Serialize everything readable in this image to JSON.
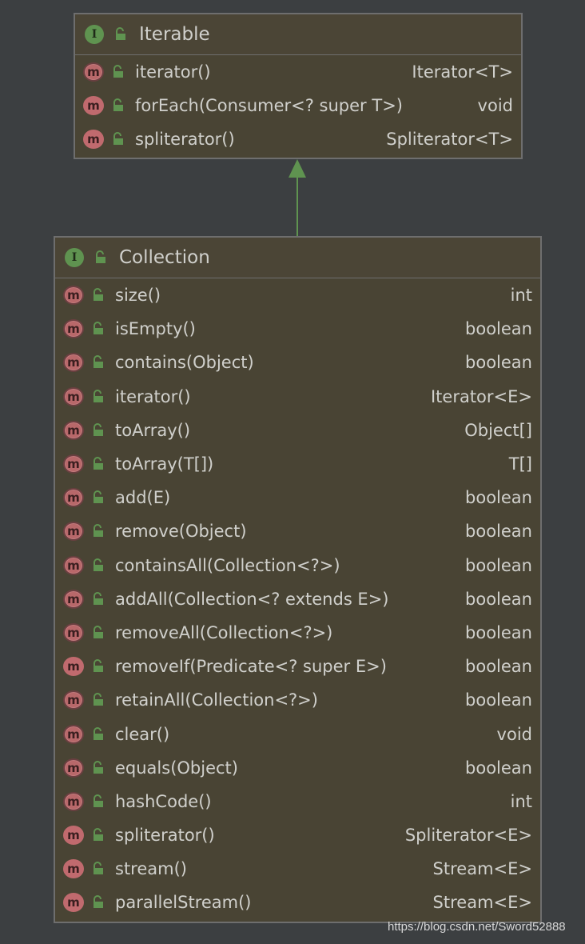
{
  "colors": {
    "background": "#3c3f41",
    "box_fill": "#494434",
    "box_border": "#6e6e6e",
    "interface_badge": "#5f9350",
    "method_badge": "#c06a6e",
    "access_lock": "#5f9350",
    "arrow": "#5f9350",
    "text": "#d0d0cc"
  },
  "iterable": {
    "badge": "I",
    "title": "Iterable",
    "methods": [
      {
        "badge": "m",
        "abstract": true,
        "icon": "public-lock-icon",
        "signature": "iterator()",
        "returns": "Iterator<T>"
      },
      {
        "badge": "m",
        "abstract": false,
        "icon": "public-lock-icon",
        "signature": "forEach(Consumer<? super T>)",
        "returns": "void"
      },
      {
        "badge": "m",
        "abstract": false,
        "icon": "public-lock-icon",
        "signature": "spliterator()",
        "returns": "Spliterator<T>"
      }
    ]
  },
  "collection": {
    "badge": "I",
    "title": "Collection",
    "methods": [
      {
        "badge": "m",
        "abstract": true,
        "icon": "public-lock-icon",
        "signature": "size()",
        "returns": "int"
      },
      {
        "badge": "m",
        "abstract": true,
        "icon": "public-lock-icon",
        "signature": "isEmpty()",
        "returns": "boolean"
      },
      {
        "badge": "m",
        "abstract": true,
        "icon": "public-lock-icon",
        "signature": "contains(Object)",
        "returns": "boolean"
      },
      {
        "badge": "m",
        "abstract": true,
        "icon": "public-lock-icon",
        "signature": "iterator()",
        "returns": "Iterator<E>"
      },
      {
        "badge": "m",
        "abstract": true,
        "icon": "public-lock-icon",
        "signature": "toArray()",
        "returns": "Object[]"
      },
      {
        "badge": "m",
        "abstract": true,
        "icon": "public-lock-icon",
        "signature": "toArray(T[])",
        "returns": "T[]"
      },
      {
        "badge": "m",
        "abstract": true,
        "icon": "public-lock-icon",
        "signature": "add(E)",
        "returns": "boolean"
      },
      {
        "badge": "m",
        "abstract": true,
        "icon": "public-lock-icon",
        "signature": "remove(Object)",
        "returns": "boolean"
      },
      {
        "badge": "m",
        "abstract": true,
        "icon": "public-lock-icon",
        "signature": "containsAll(Collection<?>)",
        "returns": "boolean"
      },
      {
        "badge": "m",
        "abstract": true,
        "icon": "public-lock-icon",
        "signature": "addAll(Collection<? extends E>)",
        "returns": "boolean"
      },
      {
        "badge": "m",
        "abstract": true,
        "icon": "public-lock-icon",
        "signature": "removeAll(Collection<?>)",
        "returns": "boolean"
      },
      {
        "badge": "m",
        "abstract": false,
        "icon": "public-lock-icon",
        "signature": "removeIf(Predicate<? super E>)",
        "returns": "boolean"
      },
      {
        "badge": "m",
        "abstract": true,
        "icon": "public-lock-icon",
        "signature": "retainAll(Collection<?>)",
        "returns": "boolean"
      },
      {
        "badge": "m",
        "abstract": true,
        "icon": "public-lock-icon",
        "signature": "clear()",
        "returns": "void"
      },
      {
        "badge": "m",
        "abstract": true,
        "icon": "public-lock-icon",
        "signature": "equals(Object)",
        "returns": "boolean"
      },
      {
        "badge": "m",
        "abstract": true,
        "icon": "public-lock-icon",
        "signature": "hashCode()",
        "returns": "int"
      },
      {
        "badge": "m",
        "abstract": false,
        "icon": "public-lock-icon",
        "signature": "spliterator()",
        "returns": "Spliterator<E>"
      },
      {
        "badge": "m",
        "abstract": false,
        "icon": "public-lock-icon",
        "signature": "stream()",
        "returns": "Stream<E>"
      },
      {
        "badge": "m",
        "abstract": false,
        "icon": "public-lock-icon",
        "signature": "parallelStream()",
        "returns": "Stream<E>"
      }
    ]
  },
  "relation": {
    "from": "collection",
    "to": "iterable",
    "type": "extends",
    "icon": "inheritance-arrow-icon"
  },
  "watermark": "https://blog.csdn.net/Sword52888"
}
